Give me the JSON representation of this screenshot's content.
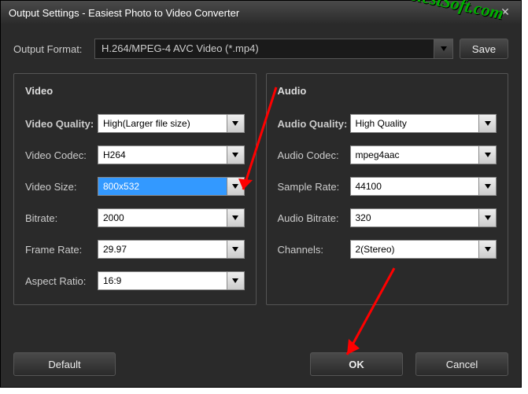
{
  "titlebar": {
    "title": "Output Settings - Easiest Photo to Video Converter"
  },
  "format": {
    "label": "Output Format:",
    "value": "H.264/MPEG-4 AVC Video (*.mp4)",
    "save": "Save"
  },
  "video": {
    "title": "Video",
    "quality_label": "Video Quality:",
    "quality": "High(Larger file size)",
    "codec_label": "Video Codec:",
    "codec": "H264",
    "size_label": "Video Size:",
    "size": "800x532",
    "bitrate_label": "Bitrate:",
    "bitrate": "2000",
    "fps_label": "Frame Rate:",
    "fps": "29.97",
    "aspect_label": "Aspect Ratio:",
    "aspect": "16:9"
  },
  "audio": {
    "title": "Audio",
    "quality_label": "Audio Quality:",
    "quality": "High Quality",
    "codec_label": "Audio Codec:",
    "codec": "mpeg4aac",
    "rate_label": "Sample Rate:",
    "rate": "44100",
    "bitrate_label": "Audio Bitrate:",
    "bitrate": "320",
    "channels_label": "Channels:",
    "channels": "2(Stereo)"
  },
  "buttons": {
    "default": "Default",
    "ok": "OK",
    "cancel": "Cancel"
  },
  "watermark": "EasiestSoft.com"
}
